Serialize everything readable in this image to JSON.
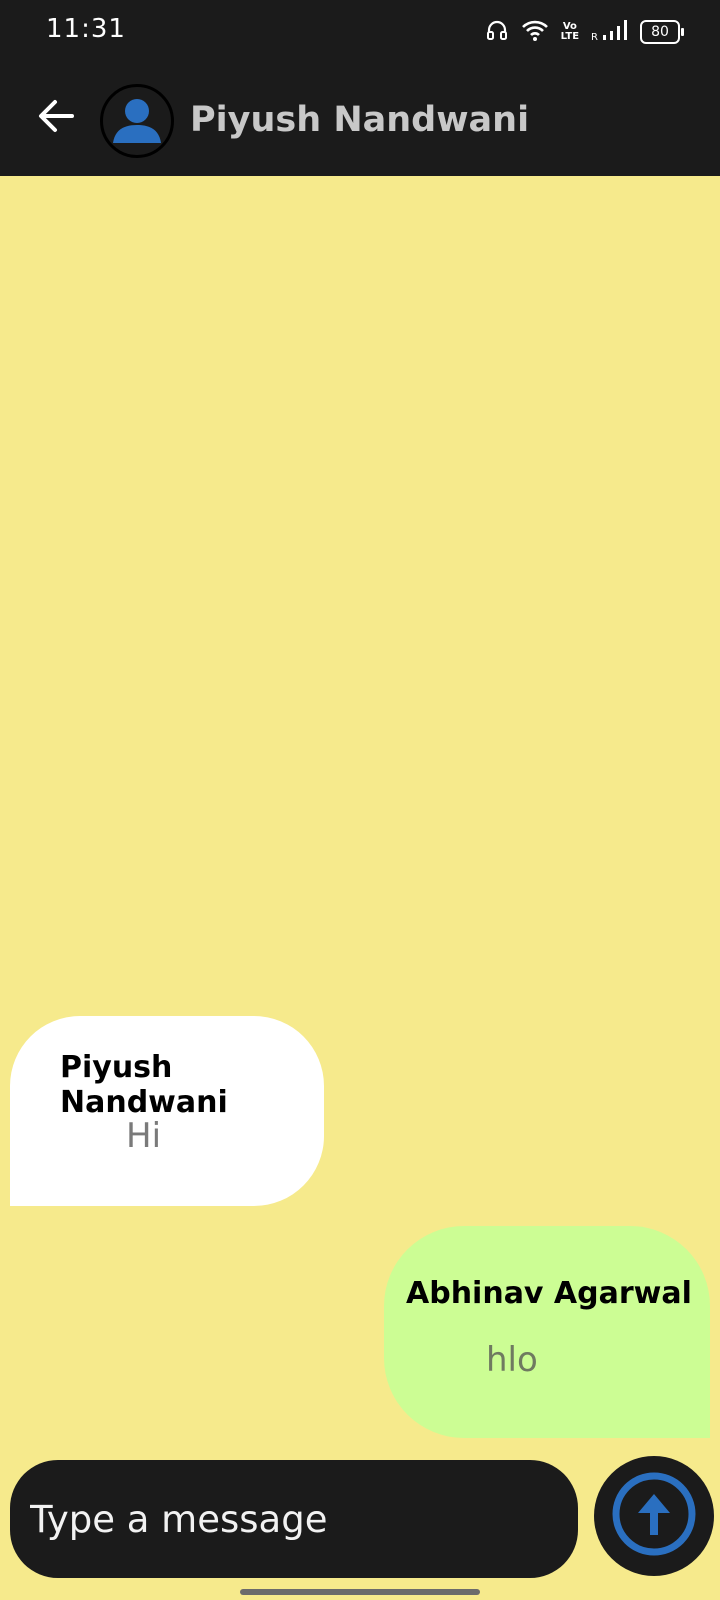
{
  "status_bar": {
    "time": "11:31",
    "battery": "80",
    "volte_line1": "Vo",
    "volte_line2": "LTE",
    "roaming": "R",
    "icons": [
      "headphones-icon",
      "wifi-icon",
      "volte-icon",
      "signal-icon",
      "battery-icon"
    ]
  },
  "header": {
    "contact_name": "Piyush Nandwani",
    "back_icon": "arrow-left-icon",
    "avatar_icon": "person-icon",
    "colors": {
      "bar": "#1b1b1b",
      "name": "#c8c8c8",
      "avatar": "#2a6fc0"
    }
  },
  "messages": [
    {
      "sender": "Piyush Nandwani",
      "text": "Hi",
      "direction": "received",
      "bubble_color": "#ffffff"
    },
    {
      "sender": "Abhinav Agarwal",
      "text": "hlo",
      "direction": "sent",
      "bubble_color": "#ccfd94"
    }
  ],
  "composer": {
    "placeholder": "Type a message",
    "send_icon": "arrow-up-circle-icon",
    "accent": "#2a6fc0"
  },
  "colors": {
    "background": "#f6ea8c"
  }
}
